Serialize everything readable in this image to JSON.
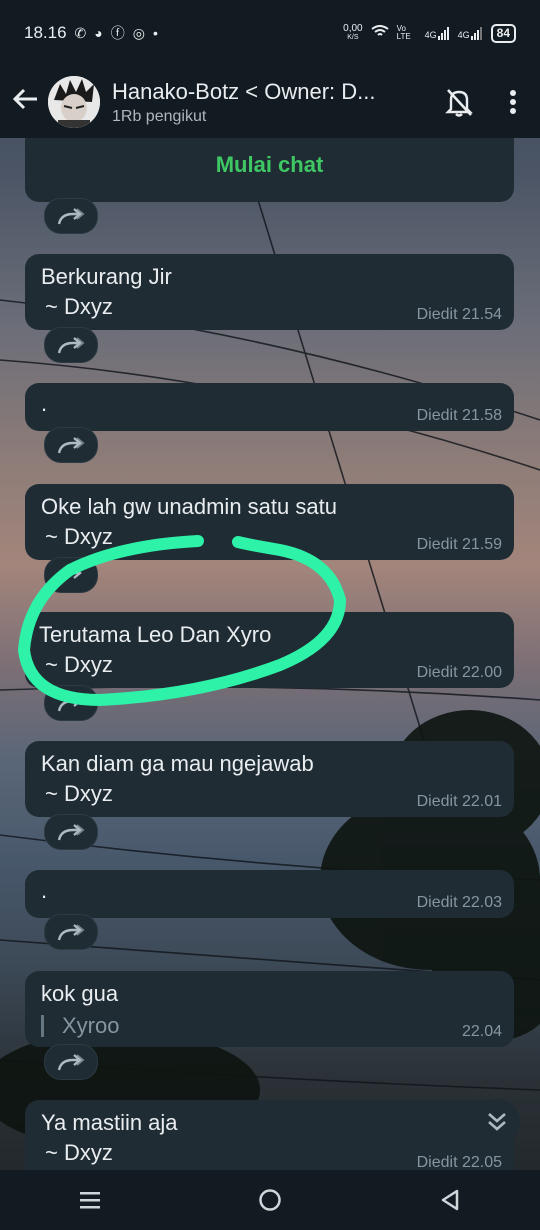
{
  "status_bar": {
    "time": "18.16",
    "netspeed_value": "0,00",
    "netspeed_unit": "K/S",
    "volte": "Vo LTE",
    "net1": "4G",
    "net2": "4G",
    "battery": "84"
  },
  "header": {
    "title": "Hanako-Botz < Owner: D...",
    "subtitle": "1Rb pengikut"
  },
  "start_chat_label": "Mulai chat",
  "messages": [
    {
      "text": "Berkurang Jir",
      "signature": "~ Dxyz",
      "meta": "Diedit 21.54"
    },
    {
      "text": ".",
      "signature": "",
      "meta": "Diedit 21.58"
    },
    {
      "text": "Oke lah gw unadmin satu satu",
      "signature": "~ Dxyz",
      "meta": "Diedit 21.59"
    },
    {
      "text": "Terutama Leo Dan Xyro",
      "signature": "~ Dxyz",
      "meta": "Diedit 22.00"
    },
    {
      "text": "Kan diam ga mau ngejawab",
      "signature": "~ Dxyz",
      "meta": "Diedit 22.01"
    },
    {
      "text": ".",
      "signature": "",
      "meta": "Diedit 22.03"
    },
    {
      "text": "kok gua",
      "quote": "Xyroo",
      "meta": "22.04"
    },
    {
      "text": "Ya mastiin aja",
      "signature": "~ Dxyz",
      "meta": "Diedit 22.05"
    }
  ],
  "colors": {
    "accent_green": "#3fc764",
    "highlight_stroke": "#2df2a8",
    "bubble_bg": "#1f2c34",
    "bar_bg": "#121b22"
  }
}
